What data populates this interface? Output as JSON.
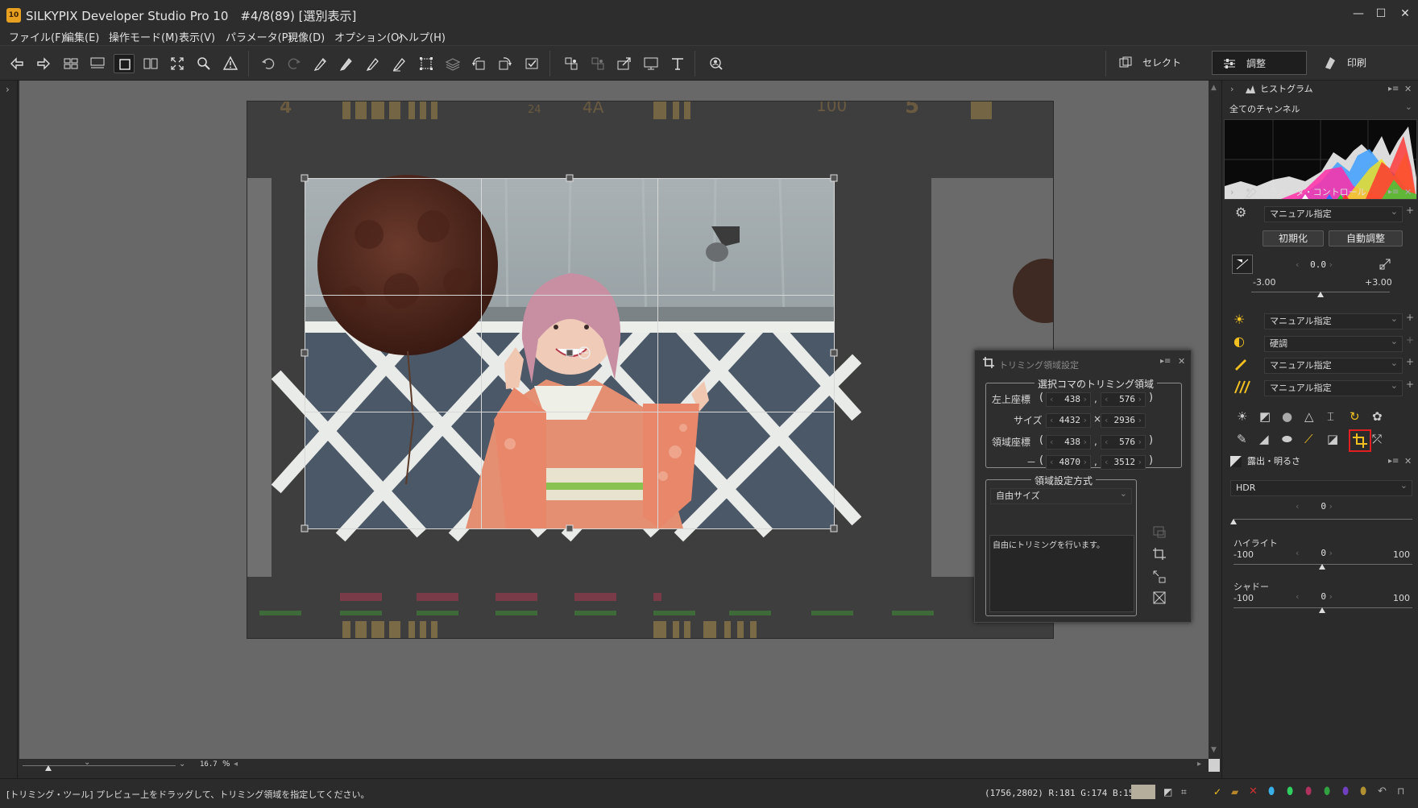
{
  "window": {
    "app_badge": "10",
    "title": "SILKYPIX Developer Studio Pro 10　#4/8(89) [選別表示]",
    "minimize": "—",
    "maximize": "☐",
    "close": "✕"
  },
  "menu": [
    "ファイル(F)",
    "編集(E)",
    "操作モード(M)",
    "表示(V)",
    "パラメータ(P)",
    "現像(D)",
    "オプション(O)",
    "ヘルプ(H)"
  ],
  "modes": {
    "select": "セレクト",
    "adjust": "調整",
    "print": "印刷"
  },
  "crop_dialog": {
    "title": "トリミング領域設定",
    "group1_title": "選択コマのトリミング領域",
    "top_left_label": "左上座標",
    "size_label": "サイズ",
    "area_label": "領域座標",
    "dash_label": "－",
    "times": "×",
    "comma": ",",
    "tl_x": "438",
    "tl_y": "576",
    "size_w": "4432",
    "size_h": "2936",
    "area_x1": "438",
    "area_y1": "576",
    "area_x2": "4870",
    "area_y2": "3512",
    "group2_title": "領域設定方式",
    "method": "自由サイズ",
    "description": "自由にトリミングを行います。"
  },
  "right_panel": {
    "histogram_title": "ヒストグラム",
    "channel": "全てのチャンネル",
    "param_title": "パラメータ・コントロール",
    "taste": "マニュアル指定",
    "init_button": "初期化",
    "auto_button": "自動調整",
    "exposure_value": "0.0",
    "exposure_min": "-3.00",
    "exposure_max": "+3.00",
    "wb": "マニュアル指定",
    "tone": "硬調",
    "sharpness": "マニュアル指定",
    "noise": "マニュアル指定",
    "exposure_panel_title": "露出・明るさ",
    "hdr_label": "HDR",
    "hdr_value": "0",
    "highlight_label": "ハイライト",
    "highlight_value": "0",
    "highlight_min": "-100",
    "highlight_max": "100",
    "shadow_label": "シャドー",
    "shadow_value": "0",
    "shadow_min": "-100",
    "shadow_max": "100",
    "plus": "+",
    "expander": "›",
    "panel_menu": "▸≡",
    "close": "✕"
  },
  "zoom": {
    "value": "16.7",
    "unit": "%"
  },
  "status": {
    "message": "[トリミング・ツール] プレビュー上をドラッグして、トリミング領域を指定してください。",
    "coords": "(1756,2802) R:181 G:174 B:156",
    "swatch_color": "#b5ae9c"
  },
  "colors": {
    "accent_highlight": "#e02020",
    "crop_icon_yellow": "#f0c020"
  }
}
